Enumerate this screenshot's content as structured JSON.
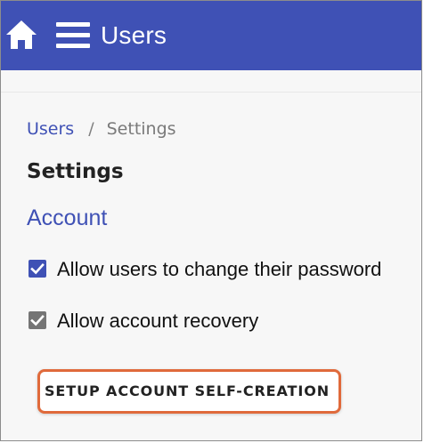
{
  "app_bar": {
    "title": "Users",
    "home_icon": "home-icon",
    "menu_icon": "menu-icon",
    "background_color": "#3f51b5",
    "text_color": "#ffffff"
  },
  "breadcrumb": {
    "items": [
      {
        "label": "Users",
        "link": true
      },
      {
        "label": "Settings",
        "link": false
      }
    ],
    "separator": "/"
  },
  "page": {
    "title": "Settings"
  },
  "account_section": {
    "title": "Account",
    "options": [
      {
        "label": "Allow users to change their password",
        "checked": true,
        "checkbox_color": "#3f51b5"
      },
      {
        "label": "Allow account recovery",
        "checked": true,
        "checkbox_color": "#757575"
      }
    ],
    "setup_button": {
      "label": "SETUP ACCOUNT SELF-CREATION",
      "highlight_color": "#e06a3b"
    }
  }
}
